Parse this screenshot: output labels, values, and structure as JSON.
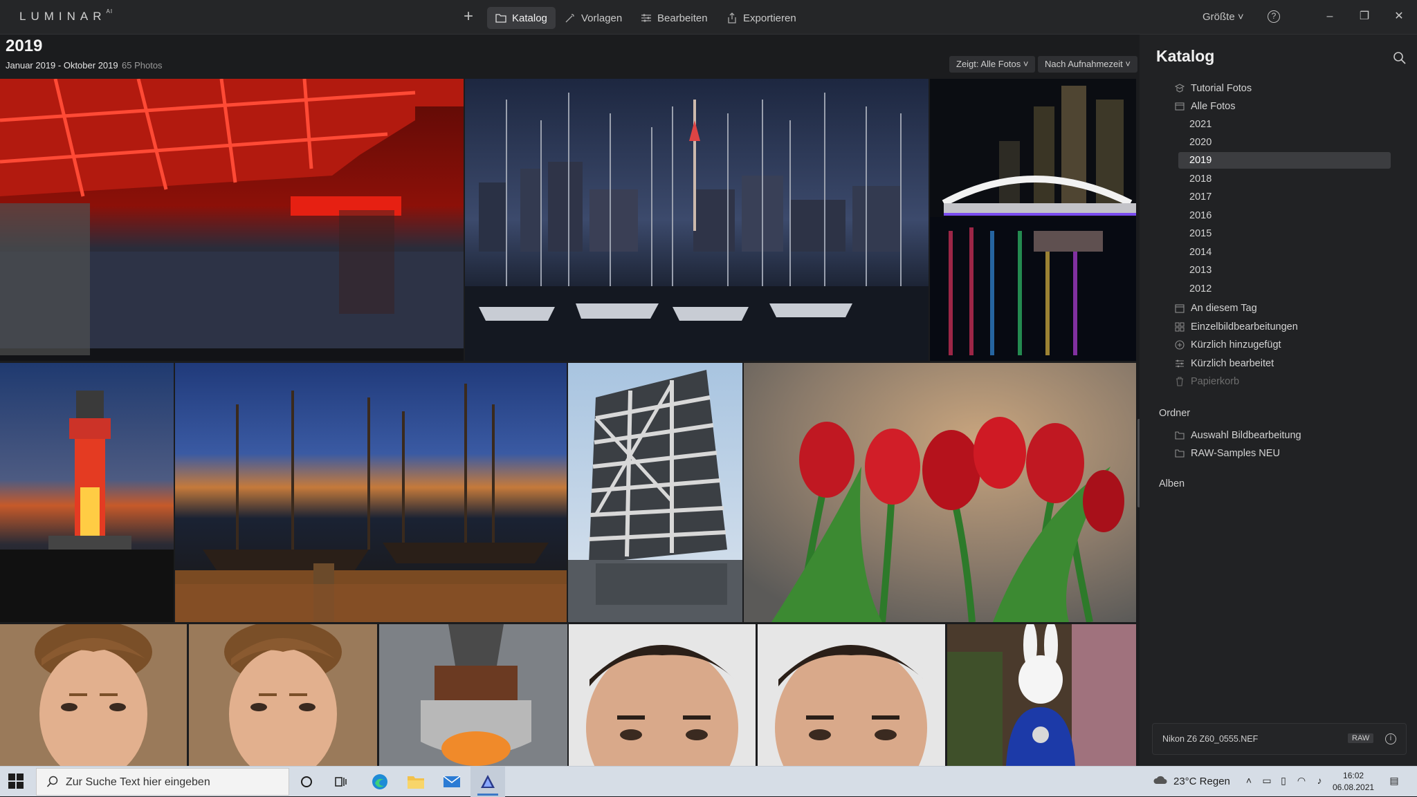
{
  "app": {
    "logo": "LUMINAR",
    "logo_sup": "AI",
    "nav": [
      {
        "label": "Katalog",
        "icon": "folder-icon",
        "active": true
      },
      {
        "label": "Vorlagen",
        "icon": "magic-wand-icon",
        "active": false
      },
      {
        "label": "Bearbeiten",
        "icon": "sliders-icon",
        "active": false
      },
      {
        "label": "Exportieren",
        "icon": "share-icon",
        "active": false
      }
    ],
    "size_menu": "Größte",
    "help": "?"
  },
  "gallery": {
    "title": "2019",
    "date_range": "Januar 2019 - Oktober 2019",
    "count": "65 Photos",
    "filter_show": "Zeigt: Alle Fotos",
    "filter_sort": "Nach Aufnahmezeit"
  },
  "panel": {
    "title": "Katalog",
    "items": [
      {
        "label": "Tutorial Fotos",
        "icon": "tutorial-icon"
      },
      {
        "label": "Alle Fotos",
        "icon": "photos-icon"
      }
    ],
    "years": [
      "2021",
      "2020",
      "2019",
      "2018",
      "2017",
      "2016",
      "2015",
      "2014",
      "2013",
      "2012"
    ],
    "active_year": "2019",
    "smart": [
      {
        "label": "An diesem Tag",
        "icon": "calendar-icon"
      },
      {
        "label": "Einzelbildbearbeitungen",
        "icon": "grid-icon"
      },
      {
        "label": "Kürzlich hinzugefügt",
        "icon": "plus-circle-icon"
      },
      {
        "label": "Kürzlich bearbeitet",
        "icon": "sliders-icon"
      },
      {
        "label": "Papierkorb",
        "icon": "trash-icon"
      }
    ],
    "folders_head": "Ordner",
    "folders": [
      "Auswahl Bildbearbeitung",
      "RAW-Samples NEU"
    ],
    "albums_head": "Alben",
    "file_name": "Nikon Z6 Z60_0555.NEF",
    "file_badge": "RAW",
    "file_info": "i"
  },
  "taskbar": {
    "search_placeholder": "Zur Suche Text hier eingeben",
    "weather": "23°C  Regen",
    "time": "16:02",
    "date": "06.08.2021"
  }
}
